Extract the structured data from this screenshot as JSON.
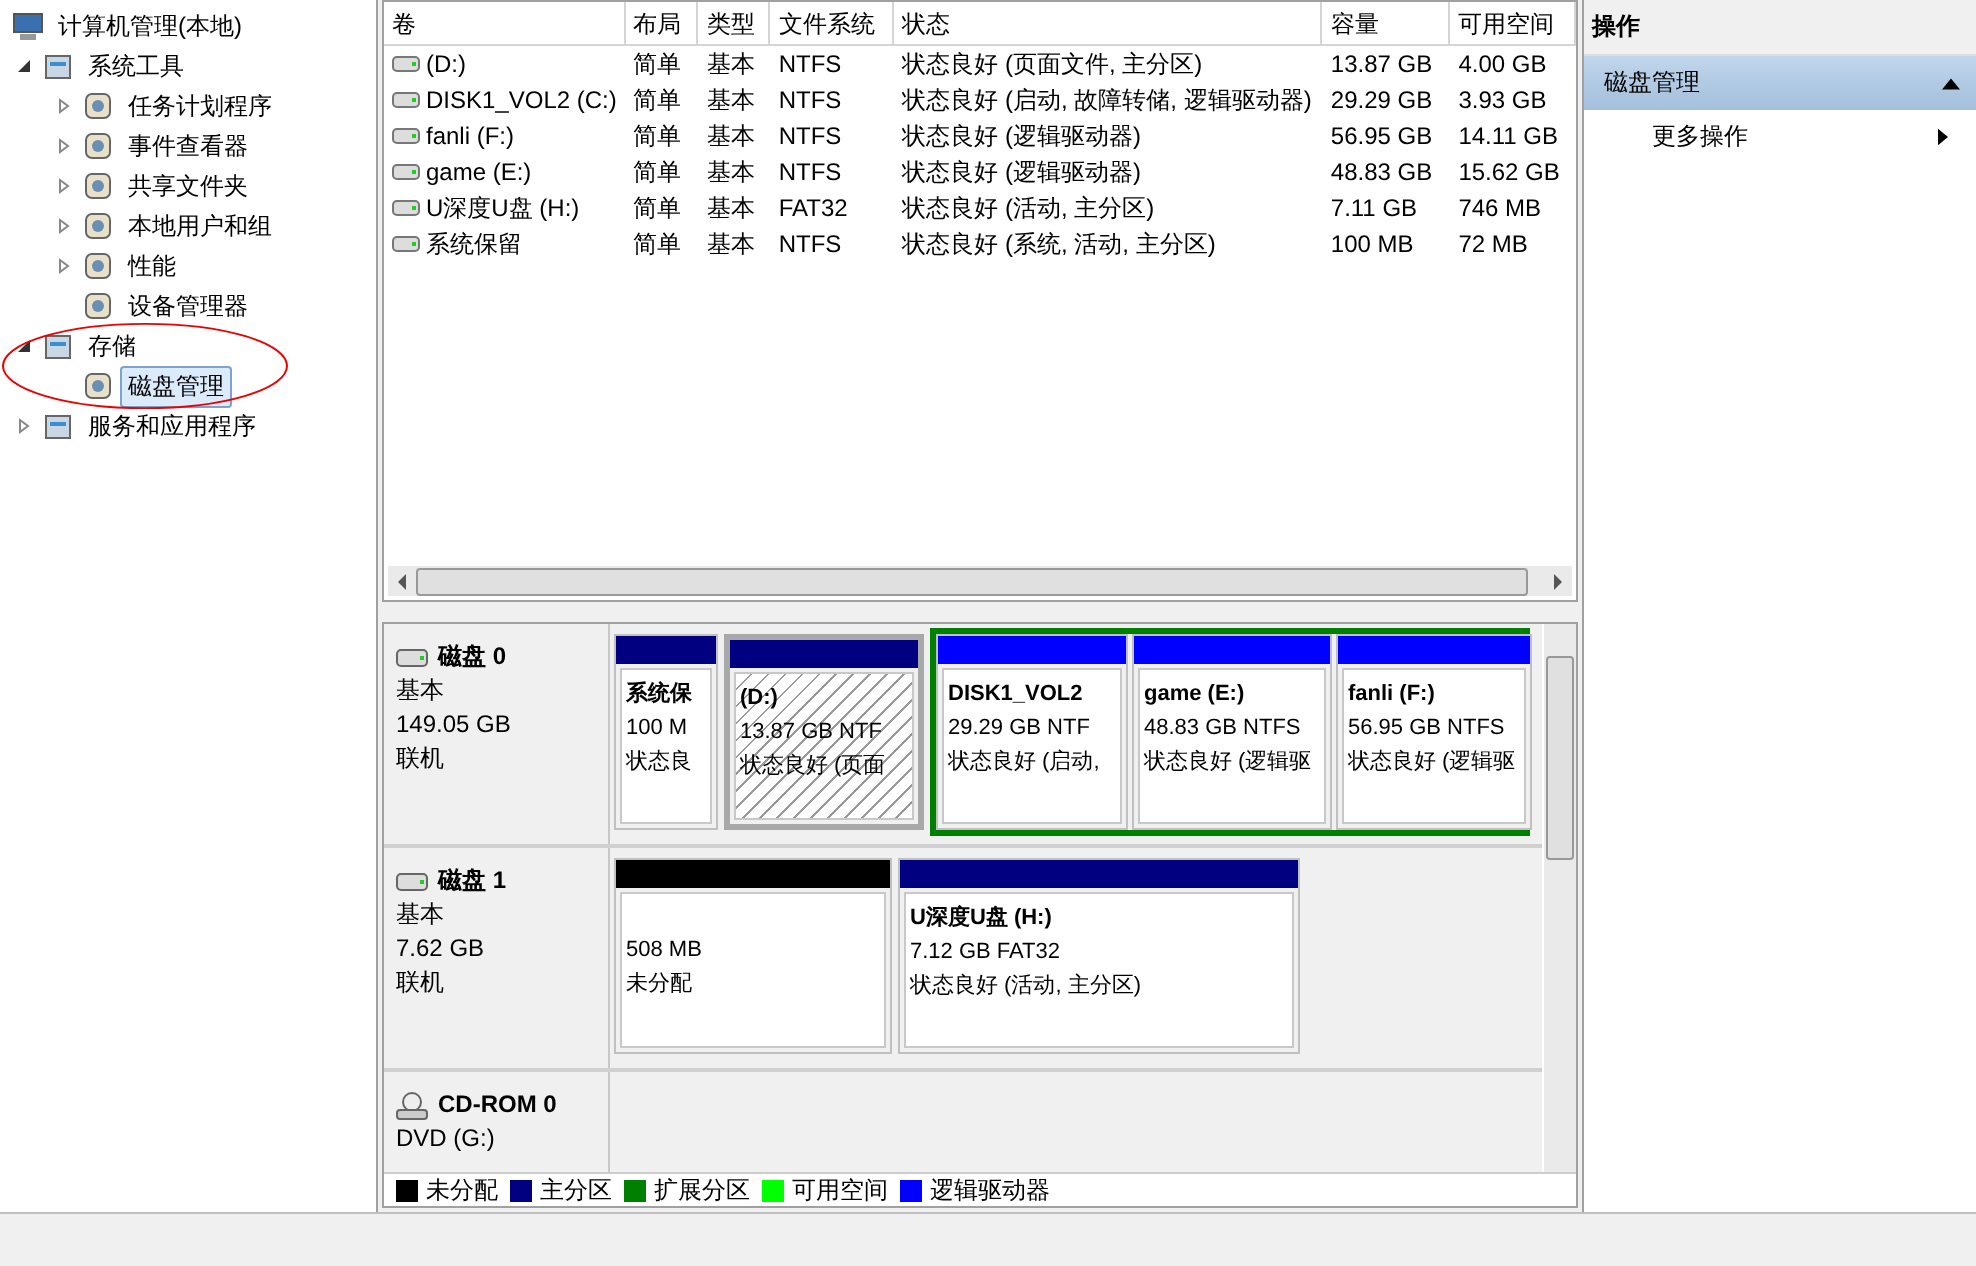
{
  "tree": {
    "label": "计算机管理(本地)",
    "children": [
      {
        "kind": "branch",
        "label": "系统工具",
        "expanded": true,
        "selected": false,
        "children": [
          {
            "kind": "branch",
            "label": "任务计划程序",
            "expanded": false,
            "selected": false
          },
          {
            "kind": "branch",
            "label": "事件查看器",
            "expanded": false,
            "selected": false
          },
          {
            "kind": "branch",
            "label": "共享文件夹",
            "expanded": false,
            "selected": false
          },
          {
            "kind": "branch",
            "label": "本地用户和组",
            "expanded": false,
            "selected": false
          },
          {
            "kind": "branch",
            "label": "性能",
            "expanded": false,
            "selected": false
          },
          {
            "kind": "leaf",
            "label": "设备管理器",
            "selected": false
          }
        ]
      },
      {
        "kind": "branch",
        "label": "存储",
        "expanded": true,
        "selected": false,
        "children": [
          {
            "kind": "leaf",
            "label": "磁盘管理",
            "selected": true
          }
        ]
      },
      {
        "kind": "branch",
        "label": "服务和应用程序",
        "expanded": false,
        "selected": false
      }
    ]
  },
  "volume_table": {
    "columns": [
      "卷",
      "布局",
      "类型",
      "文件系统",
      "状态",
      "容量",
      "可用空间"
    ],
    "rows": [
      [
        "(D:)",
        "简单",
        "基本",
        "NTFS",
        "状态良好 (页面文件, 主分区)",
        "13.87 GB",
        "4.00 GB"
      ],
      [
        "DISK1_VOL2 (C:)",
        "简单",
        "基本",
        "NTFS",
        "状态良好 (启动, 故障转储, 逻辑驱动器)",
        "29.29 GB",
        "3.93 GB"
      ],
      [
        "fanli (F:)",
        "简单",
        "基本",
        "NTFS",
        "状态良好 (逻辑驱动器)",
        "56.95 GB",
        "14.11 GB"
      ],
      [
        "game (E:)",
        "简单",
        "基本",
        "NTFS",
        "状态良好 (逻辑驱动器)",
        "48.83 GB",
        "15.62 GB"
      ],
      [
        "U深度U盘 (H:)",
        "简单",
        "基本",
        "FAT32",
        "状态良好 (活动, 主分区)",
        "7.11 GB",
        "746 MB"
      ],
      [
        "系统保留",
        "简单",
        "基本",
        "NTFS",
        "状态良好 (系统, 活动, 主分区)",
        "100 MB",
        "72 MB"
      ]
    ]
  },
  "disks": [
    {
      "kind": "disk",
      "name": "磁盘 0",
      "type": "基本",
      "size": "149.05 GB",
      "status": "联机",
      "partitions": [
        {
          "kind": "primary",
          "selected": false,
          "name": "系统保",
          "size": "100 M",
          "status": "状态良"
        },
        {
          "kind": "primary",
          "selected": true,
          "name": "(D:)",
          "size": "13.87 GB NTF",
          "status": "状态良好 (页面"
        },
        {
          "kind": "extended",
          "children": [
            {
              "kind": "logical",
              "selected": false,
              "name": "DISK1_VOL2",
              "size": "29.29 GB NTF",
              "status": "状态良好 (启动,"
            },
            {
              "kind": "logical",
              "selected": false,
              "name": "game   (E:)",
              "size": "48.83 GB NTFS",
              "status": "状态良好 (逻辑驱"
            },
            {
              "kind": "logical",
              "selected": false,
              "name": "fanli   (F:)",
              "size": "56.95 GB NTFS",
              "status": "状态良好 (逻辑驱"
            }
          ]
        }
      ]
    },
    {
      "kind": "disk",
      "name": "磁盘 1",
      "type": "基本",
      "size": "7.62 GB",
      "status": "联机",
      "partitions": [
        {
          "kind": "unallocated",
          "selected": false,
          "size": "508 MB",
          "status": "未分配"
        },
        {
          "kind": "primary",
          "selected": false,
          "name": "U深度U盘  (H:)",
          "size": "7.12 GB FAT32",
          "status": "状态良好 (活动, 主分区)"
        }
      ]
    },
    {
      "kind": "cdrom",
      "name": "CD-ROM 0",
      "type": "DVD (G:)"
    }
  ],
  "legend": [
    {
      "kind": "unallocated",
      "label": "未分配",
      "color": "#000000"
    },
    {
      "kind": "primary",
      "label": "主分区",
      "color": "#000080"
    },
    {
      "kind": "extended",
      "label": "扩展分区",
      "color": "#008000"
    },
    {
      "kind": "free",
      "label": "可用空间",
      "color": "#00ff00"
    },
    {
      "kind": "logical",
      "label": "逻辑驱动器",
      "color": "#0000ff"
    }
  ],
  "actions": {
    "title": "操作",
    "section": {
      "label": "磁盘管理",
      "expanded": true
    },
    "items": [
      "更多操作"
    ]
  }
}
